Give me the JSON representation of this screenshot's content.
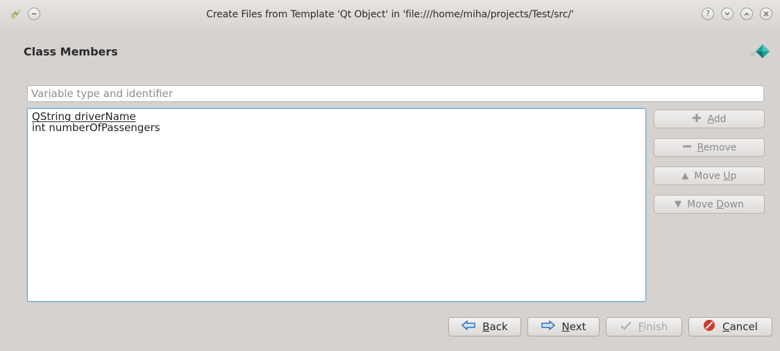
{
  "window": {
    "title": "Create Files from Template 'Qt Object' in 'file:///home/miha/projects/Test/src/'",
    "controls": [
      "help-icon",
      "minimize-icon",
      "maximize-icon",
      "close-icon"
    ]
  },
  "page": {
    "heading": "Class Members"
  },
  "variable_input": {
    "placeholder": "Variable type and identifier",
    "value": ""
  },
  "members": [
    "QString driverName",
    "int numberOfPassengers"
  ],
  "side_buttons": {
    "add": {
      "mnemonic": "A",
      "rest": "dd",
      "enabled": false
    },
    "remove": {
      "mnemonic": "R",
      "rest": "emove",
      "enabled": false
    },
    "move_up": {
      "pre": "Move ",
      "mnemonic": "U",
      "rest": "p",
      "enabled": false
    },
    "move_down": {
      "pre": "Move ",
      "mnemonic": "D",
      "rest": "own",
      "enabled": false
    }
  },
  "nav_buttons": {
    "back": {
      "mnemonic": "B",
      "rest": "ack"
    },
    "next": {
      "mnemonic": "N",
      "rest": "ext"
    },
    "finish": {
      "mnemonic": "F",
      "rest": "inish",
      "enabled": false
    },
    "cancel": {
      "mnemonic": "C",
      "rest": "ancel"
    }
  },
  "colors": {
    "window_bg": "#d6d2d0",
    "focus_border": "#5aa5dc",
    "arrow_blue": "#2f6fb6",
    "cancel_red": "#d33a2c"
  }
}
